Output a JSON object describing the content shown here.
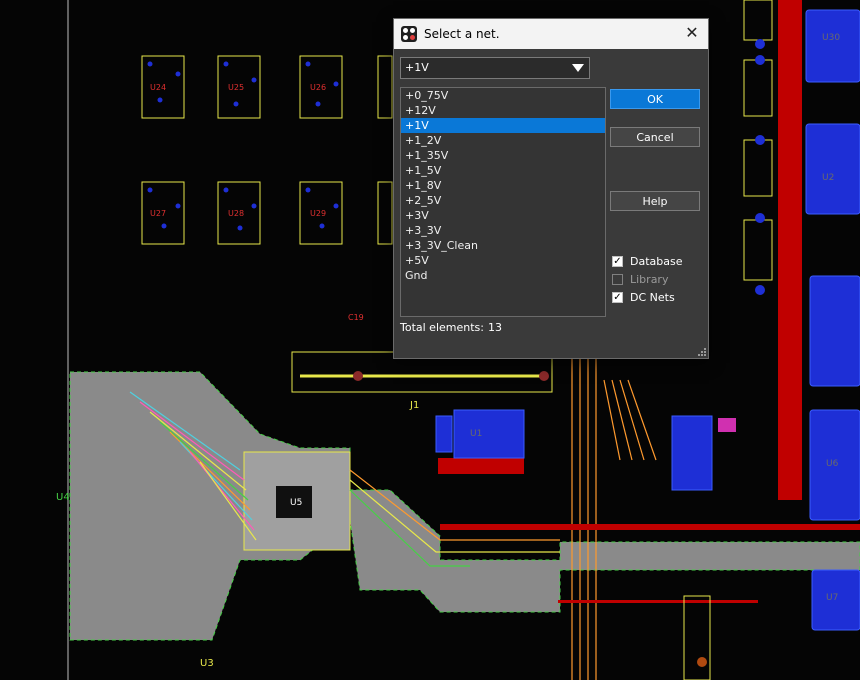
{
  "canvas": {
    "labels": [
      "U24",
      "U25",
      "U26",
      "U27",
      "U28",
      "U29",
      "U30",
      "J1",
      "U1",
      "U2",
      "U3",
      "U4",
      "U5",
      "U6",
      "U7",
      "C19"
    ],
    "colors": {
      "background": "#050505",
      "board": "#8a8a8a",
      "copper_red": "#c00000",
      "pad_blue": "#1e2fd6",
      "trace_orange": "#ff9a2e",
      "trace_cyan": "#4fd0e0",
      "trace_green": "#46d046",
      "trace_yellow": "#e8e84a",
      "trace_pink": "#ff5ab8"
    }
  },
  "dialog": {
    "title": "Select a net.",
    "selected_net": "+1V",
    "nets": [
      "+0_75V",
      "+12V",
      "+1V",
      "+1_2V",
      "+1_35V",
      "+1_5V",
      "+1_8V",
      "+2_5V",
      "+3V",
      "+3_3V",
      "+3_3V_Clean",
      "+5V",
      "Gnd"
    ],
    "selected_index": 2,
    "buttons": {
      "ok": "OK",
      "cancel": "Cancel",
      "help": "Help"
    },
    "checkboxes": [
      {
        "label": "Database",
        "checked": true,
        "enabled": true
      },
      {
        "label": "Library",
        "checked": false,
        "enabled": false
      },
      {
        "label": "DC Nets",
        "checked": true,
        "enabled": true
      }
    ],
    "total_label": "Total elements:",
    "total_count": "13",
    "icons": {
      "app": "app-icon",
      "close": "close-icon",
      "dropdown": "chevron-down-icon",
      "check": "checkmark-icon",
      "resize": "resize-grip-icon"
    }
  }
}
